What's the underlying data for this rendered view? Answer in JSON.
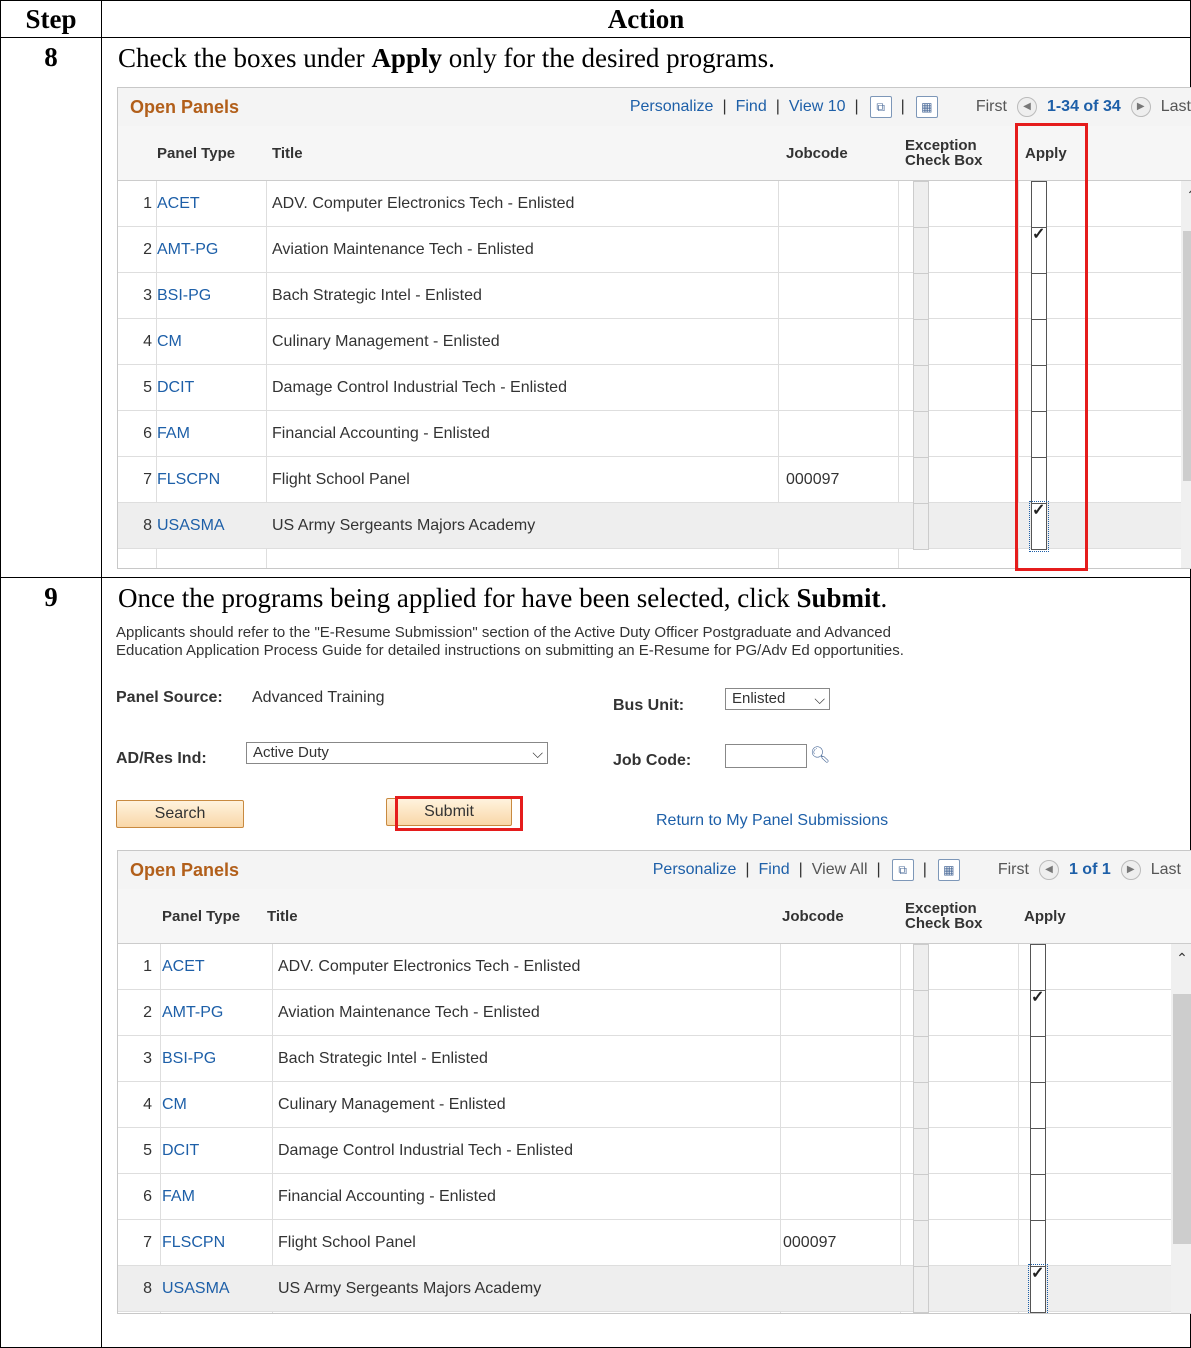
{
  "header": {
    "step": "Step",
    "action": "Action"
  },
  "step8": {
    "number": "8",
    "instruction_pre": "Check the boxes under ",
    "instruction_bold": "Apply",
    "instruction_post": " only for the desired programs."
  },
  "step9": {
    "number": "9",
    "instruction_pre": "Once the programs being applied for have been selected, click ",
    "instruction_bold": "Submit",
    "instruction_post": "."
  },
  "grid1": {
    "title": "Open Panels",
    "personalize": "Personalize",
    "find": "Find",
    "view": "View 10",
    "first": "First",
    "range": "1-34 of 34",
    "last": "Last"
  },
  "grid2": {
    "title": "Open Panels",
    "personalize": "Personalize",
    "find": "Find",
    "view": "View All",
    "first": "First",
    "range": "1 of 1",
    "last": "Last"
  },
  "columns": {
    "panel_type": "Panel Type",
    "title": "Title",
    "jobcode": "Jobcode",
    "exception_1": "Exception",
    "exception_2": "Check Box",
    "apply": "Apply"
  },
  "rows": [
    {
      "n": "1",
      "type": "ACET",
      "title": "ADV. Computer Electronics Tech - Enlisted",
      "jobcode": "",
      "apply": false
    },
    {
      "n": "2",
      "type": "AMT-PG",
      "title": "Aviation Maintenance Tech - Enlisted",
      "jobcode": "",
      "apply": true
    },
    {
      "n": "3",
      "type": "BSI-PG",
      "title": "Bach Strategic Intel - Enlisted",
      "jobcode": "",
      "apply": false
    },
    {
      "n": "4",
      "type": "CM",
      "title": "Culinary Management - Enlisted",
      "jobcode": "",
      "apply": false
    },
    {
      "n": "5",
      "type": "DCIT",
      "title": "Damage Control Industrial Tech - Enlisted",
      "jobcode": "",
      "apply": false
    },
    {
      "n": "6",
      "type": "FAM",
      "title": "Financial Accounting - Enlisted",
      "jobcode": "",
      "apply": false
    },
    {
      "n": "7",
      "type": "FLSCPN",
      "title": "Flight School Panel",
      "jobcode": "000097",
      "apply": false
    },
    {
      "n": "8",
      "type": "USASMA",
      "title": "US Army Sergeants Majors Academy",
      "jobcode": "",
      "apply": true
    }
  ],
  "form": {
    "info_line1": "Applicants should refer to the \"E-Resume Submission\" section of the Active Duty Officer Postgraduate and Advanced",
    "info_line2": "Education Application Process Guide for detailed instructions on submitting an E-Resume for PG/Adv Ed opportunities.",
    "panel_source_label": "Panel Source:",
    "panel_source_value": "Advanced Training",
    "bus_unit_label": "Bus Unit:",
    "bus_unit_value": "Enlisted",
    "ad_res_label": "AD/Res Ind:",
    "ad_res_value": "Active Duty",
    "job_code_label": "Job Code:",
    "search_button": "Search",
    "submit_button": "Submit",
    "return_link": "Return to My Panel Submissions"
  },
  "icons": {
    "popout": "popout-icon",
    "download": "download-grid-icon",
    "first": "first-arrow-icon",
    "last": "last-arrow-icon",
    "lookup": "magnifier-icon"
  },
  "colors": {
    "link": "#1d5fa8",
    "title": "#b25f1a",
    "highlight": "#e51c1c"
  }
}
